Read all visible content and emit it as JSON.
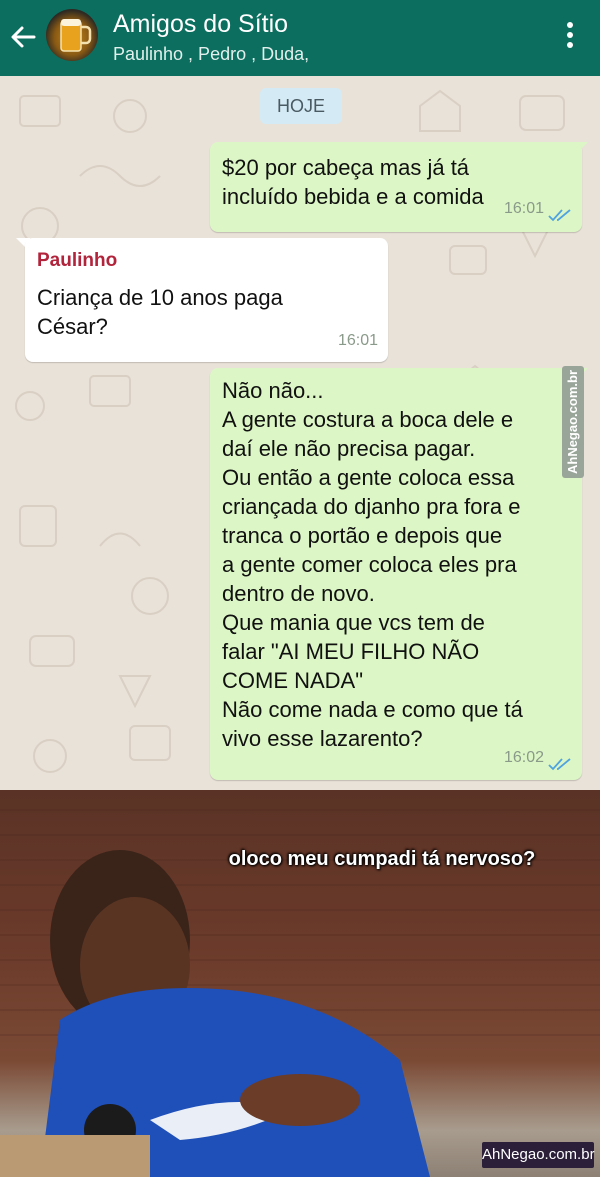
{
  "header": {
    "title": "Amigos do Sítio",
    "subtitle": "Paulinho , Pedro , Duda,",
    "back_icon": "arrow-left-icon",
    "menu_icon": "more-vertical-icon",
    "colors": {
      "bar": "#0b6e5f"
    }
  },
  "chat": {
    "day_label": "HOJE",
    "messages": [
      {
        "direction": "out",
        "text": "$20 por cabeça mas já tá\nincluído bebida e a comida",
        "time": "16:01",
        "status_icon": "double-check-icon"
      },
      {
        "direction": "in",
        "sender": "Paulinho",
        "text": "Criança de 10 anos paga\nCésar?",
        "time": "16:01"
      },
      {
        "direction": "out",
        "text": "Não não...\nA gente costura a boca dele e\ndaí ele não precisa pagar.\nOu então a gente coloca essa\ncriançada do djanho pra fora e\ntranca o portão e depois que\na gente comer coloca eles pra\ndentro de novo.\nQue mania que vcs tem de\nfalar \"AI MEU FILHO NÃO\nCOME NADA\"\nNão come nada e como que tá\nvivo esse lazarento?",
        "time": "16:02",
        "status_icon": "double-check-icon"
      }
    ],
    "colors": {
      "outgoing": "#dcf7c5",
      "incoming": "#ffffff",
      "sender": "#b2243c",
      "ticks": "#4fa3e0"
    }
  },
  "watermark": {
    "side_text": "AhNegao.com.br"
  },
  "meme": {
    "caption": "oloco meu cumpadi tá nervoso?",
    "watermark": "AhNegao.com.br"
  }
}
